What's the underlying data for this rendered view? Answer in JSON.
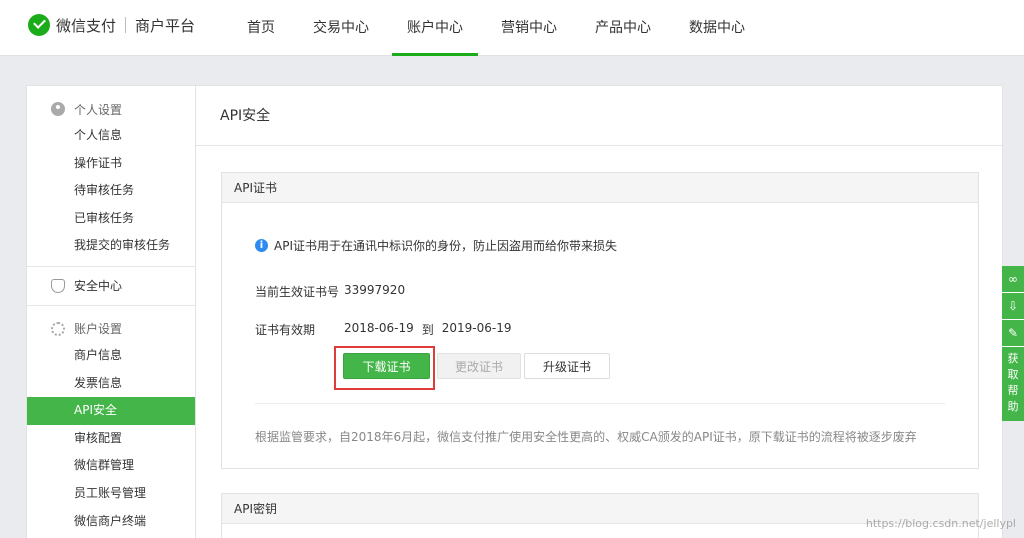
{
  "header": {
    "brand": "微信支付",
    "subbrand": "商户平台",
    "nav": [
      {
        "label": "首页"
      },
      {
        "label": "交易中心"
      },
      {
        "label": "账户中心"
      },
      {
        "label": "营销中心"
      },
      {
        "label": "产品中心"
      },
      {
        "label": "数据中心"
      }
    ],
    "active_nav": "账户中心"
  },
  "sidebar": {
    "personal": {
      "title": "个人设置",
      "items": [
        "个人信息",
        "操作证书",
        "待审核任务",
        "已审核任务",
        "我提交的审核任务"
      ]
    },
    "security": {
      "title": "安全中心"
    },
    "account": {
      "title": "账户设置",
      "items": [
        "商户信息",
        "发票信息",
        "API安全",
        "审核配置",
        "微信群管理",
        "员工账号管理",
        "微信商户终端"
      ],
      "active": "API安全"
    }
  },
  "main": {
    "title": "API安全",
    "cert_panel": {
      "title": "API证书",
      "notice": "API证书用于在通讯中标识你的身份，防止因盗用而给你带来损失",
      "cert_no_label": "当前生效证书号",
      "cert_no": "33997920",
      "validity_label": "证书有效期",
      "valid_from": "2018-06-19",
      "valid_to_sep": "到",
      "valid_to": "2019-06-19",
      "buttons": {
        "download": "下载证书",
        "change": "更改证书",
        "upgrade": "升级证书"
      },
      "footnote": "根据监管要求，自2018年6月起，微信支付推广使用安全性更高的、权威CA颁发的API证书，原下载证书的流程将被逐步废弃"
    },
    "key_panel": {
      "title": "API密钥"
    }
  },
  "side_tools": {
    "help": "获取帮助"
  },
  "watermark": "https://blog.csdn.net/jellypl"
}
